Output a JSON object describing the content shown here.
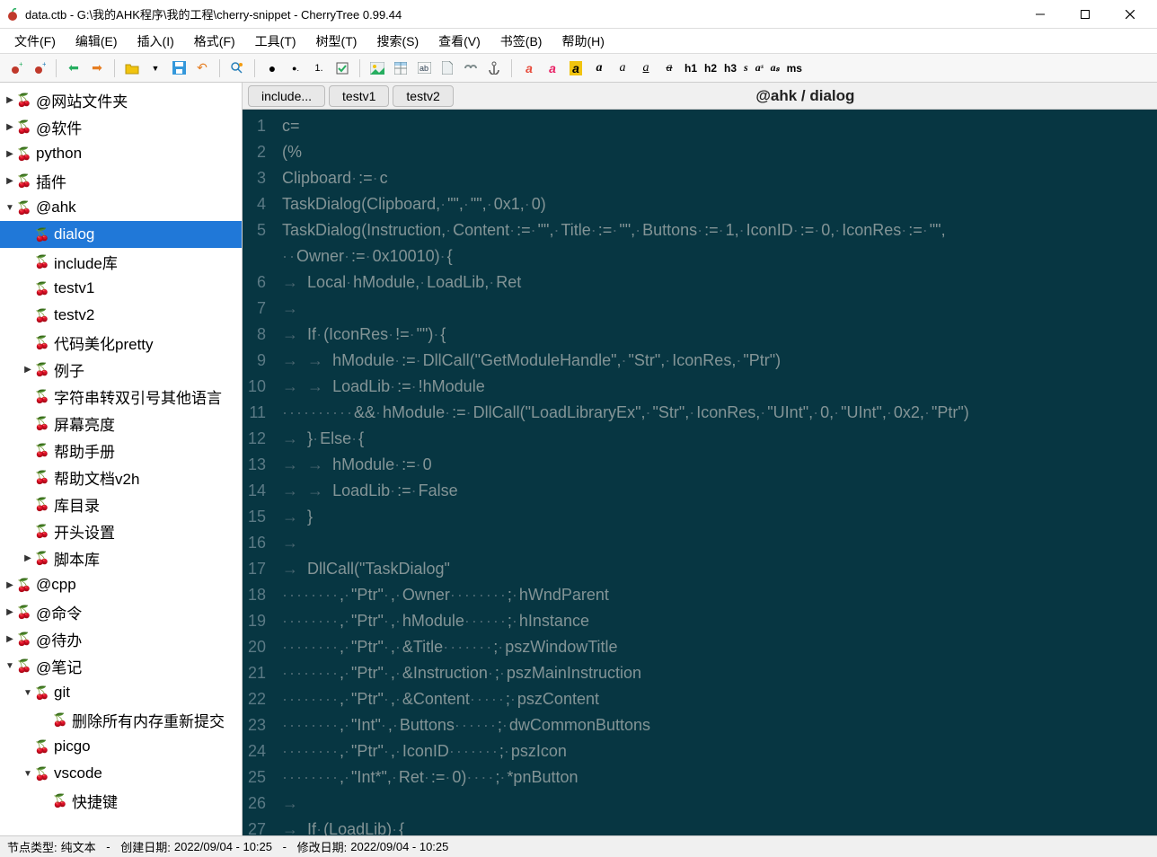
{
  "window": {
    "title": "data.ctb - G:\\我的AHK程序\\我的工程\\cherry-snippet - CherryTree 0.99.44"
  },
  "menu": [
    "文件(F)",
    "编辑(E)",
    "插入(I)",
    "格式(F)",
    "工具(T)",
    "树型(T)",
    "搜索(S)",
    "查看(V)",
    "书签(B)",
    "帮助(H)"
  ],
  "toolbar_headings": [
    "h1",
    "h2",
    "h3"
  ],
  "toolbar_tokens": [
    "s",
    "aˢ",
    "aₛ",
    "ms"
  ],
  "tree": [
    {
      "d": 0,
      "a": "▶",
      "c": "r",
      "t": "@网站文件夹"
    },
    {
      "d": 0,
      "a": "▶",
      "c": "r",
      "t": "@软件"
    },
    {
      "d": 0,
      "a": "▶",
      "c": "r",
      "t": "python"
    },
    {
      "d": 0,
      "a": "▶",
      "c": "r",
      "t": "插件"
    },
    {
      "d": 0,
      "a": "▼",
      "c": "r",
      "t": "@ahk"
    },
    {
      "d": 1,
      "a": "",
      "c": "b",
      "t": "dialog",
      "sel": true
    },
    {
      "d": 1,
      "a": "",
      "c": "b",
      "t": "include库"
    },
    {
      "d": 1,
      "a": "",
      "c": "b",
      "t": "testv1"
    },
    {
      "d": 1,
      "a": "",
      "c": "b",
      "t": "testv2"
    },
    {
      "d": 1,
      "a": "",
      "c": "b",
      "t": "代码美化pretty"
    },
    {
      "d": 1,
      "a": "▶",
      "c": "b",
      "t": "例子"
    },
    {
      "d": 1,
      "a": "",
      "c": "b",
      "t": "字符串转双引号其他语言"
    },
    {
      "d": 1,
      "a": "",
      "c": "b",
      "t": "屏幕亮度"
    },
    {
      "d": 1,
      "a": "",
      "c": "b",
      "t": "帮助手册"
    },
    {
      "d": 1,
      "a": "",
      "c": "b",
      "t": "帮助文档v2h"
    },
    {
      "d": 1,
      "a": "",
      "c": "b",
      "t": "库目录"
    },
    {
      "d": 1,
      "a": "",
      "c": "b",
      "t": "开头设置"
    },
    {
      "d": 1,
      "a": "▶",
      "c": "b",
      "t": "脚本库"
    },
    {
      "d": 0,
      "a": "▶",
      "c": "r",
      "t": "@cpp"
    },
    {
      "d": 0,
      "a": "▶",
      "c": "r",
      "t": "@命令"
    },
    {
      "d": 0,
      "a": "▶",
      "c": "r",
      "t": "@待办"
    },
    {
      "d": 0,
      "a": "▼",
      "c": "r",
      "t": "@笔记"
    },
    {
      "d": 1,
      "a": "▼",
      "c": "b",
      "t": "git"
    },
    {
      "d": 2,
      "a": "",
      "c": "o",
      "t": "删除所有内存重新提交"
    },
    {
      "d": 1,
      "a": "",
      "c": "b",
      "t": "picgo"
    },
    {
      "d": 1,
      "a": "▼",
      "c": "b",
      "t": "vscode"
    },
    {
      "d": 2,
      "a": "",
      "c": "o",
      "t": "快捷键"
    }
  ],
  "breadcrumb": [
    "include...",
    "testv1",
    "testv2"
  ],
  "doc_title": "@ahk / dialog",
  "code": [
    {
      "n": 1,
      "t": "c="
    },
    {
      "n": 2,
      "t": "(%"
    },
    {
      "n": 3,
      "t": "Clipboard := c"
    },
    {
      "n": 4,
      "t": "TaskDialog(Clipboard, \"\", \"\", 0x1, 0)"
    },
    {
      "n": 5,
      "t": "TaskDialog(Instruction, Content := \"\", Title := \"\", Buttons := 1, IconID := 0, IconRes := \"\","
    },
    {
      "n": 0,
      "t": "  Owner := 0x10010) {",
      "wrap": true
    },
    {
      "n": 6,
      "t": "→Local hModule, LoadLib, Ret"
    },
    {
      "n": 7,
      "t": "→"
    },
    {
      "n": 8,
      "t": "→If (IconRes != \"\") {"
    },
    {
      "n": 9,
      "t": "→→hModule := DllCall(\"GetModuleHandle\", \"Str\", IconRes, \"Ptr\")"
    },
    {
      "n": 10,
      "t": "→→LoadLib := !hModule"
    },
    {
      "n": 11,
      "t": "··········&& hModule := DllCall(\"LoadLibraryEx\", \"Str\", IconRes, \"UInt\", 0, \"UInt\", 0x2, \"Ptr\")"
    },
    {
      "n": 12,
      "t": "→} Else {"
    },
    {
      "n": 13,
      "t": "→→hModule := 0"
    },
    {
      "n": 14,
      "t": "→→LoadLib := False"
    },
    {
      "n": 15,
      "t": "→}"
    },
    {
      "n": 16,
      "t": "→"
    },
    {
      "n": 17,
      "t": "→DllCall(\"TaskDialog\""
    },
    {
      "n": 18,
      "t": "········, \"Ptr\" , Owner········; hWndParent"
    },
    {
      "n": 19,
      "t": "········, \"Ptr\" , hModule······; hInstance"
    },
    {
      "n": 20,
      "t": "········, \"Ptr\" , &Title·······; pszWindowTitle"
    },
    {
      "n": 21,
      "t": "········, \"Ptr\" , &Instruction·; pszMainInstruction"
    },
    {
      "n": 22,
      "t": "········, \"Ptr\" , &Content·····; pszContent"
    },
    {
      "n": 23,
      "t": "········, \"Int\" , Buttons······; dwCommonButtons"
    },
    {
      "n": 24,
      "t": "········, \"Ptr\" , IconID·······; pszIcon"
    },
    {
      "n": 25,
      "t": "········, \"Int*\", Ret := 0)····; *pnButton"
    },
    {
      "n": 26,
      "t": "→"
    },
    {
      "n": 27,
      "t": "→If (LoadLib) {"
    }
  ],
  "status": {
    "node_type_label": "节点类型:",
    "node_type_value": "纯文本",
    "created_label": "创建日期:",
    "created_value": "2022/09/04 - 10:25",
    "modified_label": "修改日期:",
    "modified_value": "2022/09/04 - 10:25",
    "sep": "-"
  }
}
